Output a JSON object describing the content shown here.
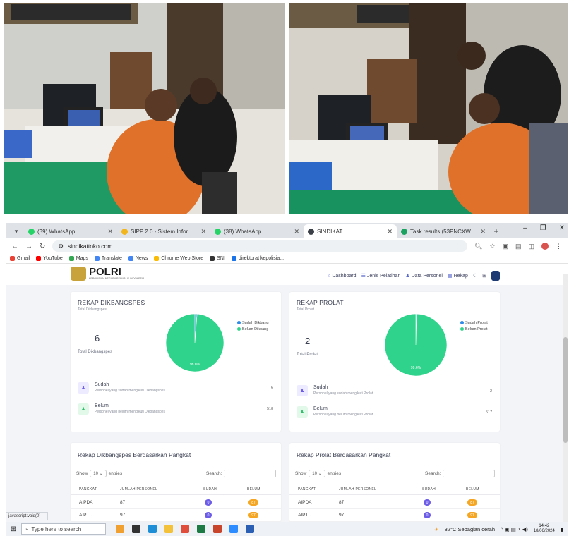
{
  "tabs": [
    {
      "title": "(39) WhatsApp",
      "icon": "whatsapp-icon",
      "active": false
    },
    {
      "title": "SIPP 2.0 - Sistem Informasi P",
      "icon": "sipp-icon",
      "active": false
    },
    {
      "title": "(38) WhatsApp",
      "icon": "whatsapp-icon",
      "active": false
    },
    {
      "title": "SINDIKAT",
      "icon": "sindikat-icon",
      "active": true
    },
    {
      "title": "Task results (53PNCXW-202",
      "icon": "task-icon",
      "active": false
    }
  ],
  "browser": {
    "url": "sindikattoko.com"
  },
  "bookmarks": [
    {
      "label": "Gmail",
      "color": "#ea4335"
    },
    {
      "label": "YouTube",
      "color": "#ff0000"
    },
    {
      "label": "Maps",
      "color": "#34a853"
    },
    {
      "label": "Translate",
      "color": "#4285f4"
    },
    {
      "label": "News",
      "color": "#4285f4"
    },
    {
      "label": "Chrome Web Store",
      "color": "#fbbc05"
    },
    {
      "label": "SNI",
      "color": "#333333"
    },
    {
      "label": "direktorat kepolisia...",
      "color": "#1a73e8"
    }
  ],
  "app": {
    "logo_text": "POLRI",
    "logo_sub": "KEPOLISIAN NEGARA REPUBLIK INDONESIA",
    "nav": [
      {
        "label": "Dashboard",
        "icon": "home-icon"
      },
      {
        "label": "Jenis Pelatihan",
        "icon": "list-icon"
      },
      {
        "label": "Data Personel",
        "icon": "users-icon"
      },
      {
        "label": "Rekap",
        "icon": "report-icon"
      }
    ]
  },
  "dikbang": {
    "title": "REKAP DIKBANGSPES",
    "subtitle": "Total Dikbangspes",
    "total": "6",
    "total_caption": "Total Dikbangspes",
    "legend": [
      "Sudah Dikbang",
      "Belum Dikbang"
    ],
    "sudah_title": "Sudah",
    "sudah_desc": "Personel yang sudah mengikuti Dikbangspes",
    "sudah_value": "6",
    "belum_title": "Belum",
    "belum_desc": "Personel yang belum mengikuti Dikbangspes",
    "belum_value": "518"
  },
  "prolat": {
    "title": "REKAP PROLAT",
    "subtitle": "Total Prolat",
    "total": "2",
    "total_caption": "Total Prolat",
    "legend": [
      "Sudah Prolat",
      "Belum Prolat"
    ],
    "sudah_title": "Sudah",
    "sudah_desc": "Personel yang sudah mengikuti Prolat",
    "sudah_value": "2",
    "belum_title": "Belum",
    "belum_desc": "Personel yang belum mengikuti Prolat",
    "belum_value": "517"
  },
  "chart_data": [
    {
      "type": "pie",
      "categories": [
        "Sudah Dikbang",
        "Belum Dikbang"
      ],
      "values": [
        1.2,
        98.8
      ],
      "colors": [
        "#2e8be8",
        "#2fd38b"
      ],
      "data_label": "98.8%"
    },
    {
      "type": "pie",
      "categories": [
        "Sudah Prolat",
        "Belum Prolat"
      ],
      "values": [
        0.4,
        99.6
      ],
      "colors": [
        "#2e8be8",
        "#2fd38b"
      ],
      "data_label": "99.6%"
    }
  ],
  "table_left": {
    "title": "Rekap Dikbangspes Berdasarkan Pangkat",
    "show": "Show",
    "entries_value": "10",
    "entries": "entries",
    "search": "Search:",
    "headers": [
      "PANGKAT",
      "JUMLAH PERSONEL",
      "SUDAH",
      "BELUM"
    ],
    "rows": [
      {
        "pangkat": "AIPDA",
        "jumlah": "87",
        "sudah": "0",
        "belum": "87"
      },
      {
        "pangkat": "AIPTU",
        "jumlah": "97",
        "sudah": "0",
        "belum": "97"
      }
    ]
  },
  "table_right": {
    "title": "Rekap Prolat Berdasarkan Pangkat",
    "show": "Show",
    "entries_value": "10",
    "entries": "entries",
    "search": "Search:",
    "headers": [
      "PANGKAT",
      "JUMLAH PERSONEL",
      "SUDAH",
      "BELUM"
    ],
    "rows": [
      {
        "pangkat": "AIPDA",
        "jumlah": "87",
        "sudah": "0",
        "belum": "87"
      },
      {
        "pangkat": "AIPTU",
        "jumlah": "97",
        "sudah": "0",
        "belum": "97"
      }
    ]
  },
  "status_link": "javascript:void(0)",
  "taskbar": {
    "search_placeholder": "Type here to search",
    "weather": "32°C  Sebagian cerah",
    "time": "14:42",
    "date": "18/06/2024"
  },
  "colors": {
    "accent": "#5a6acf",
    "sudah": "#6c5ce7",
    "belum": "#f5a623",
    "pie_green": "#2fd38b",
    "pie_blue": "#2e8be8"
  }
}
